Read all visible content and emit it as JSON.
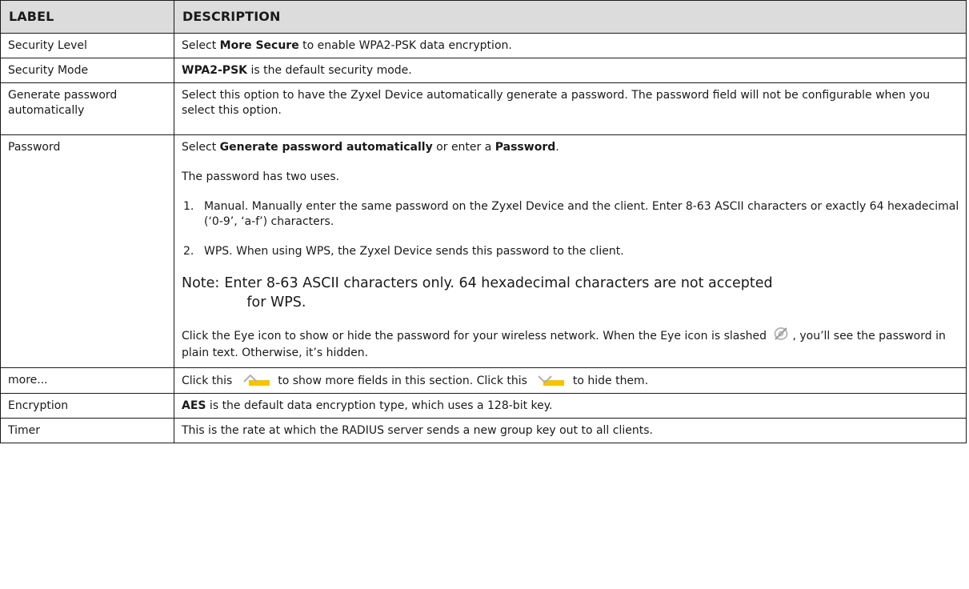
{
  "table": {
    "header": {
      "label": "LABEL",
      "description": "DESCRIPTION"
    },
    "rows": {
      "security_level": {
        "label": "Security Level",
        "pre": "Select ",
        "bold": "More Secure",
        "post": " to enable WPA2-PSK data encryption."
      },
      "security_mode": {
        "label": "Security Mode",
        "bold": "WPA2-PSK",
        "post": " is the default security mode."
      },
      "generate_password": {
        "label": "Generate password automatically",
        "text": "Select this option to have the Zyxel Device automatically generate a password. The password field will not be configurable when you select this option."
      },
      "password": {
        "label": "Password",
        "p1_pre": "Select ",
        "p1_bold1": "Generate password automatically",
        "p1_mid": " or enter a ",
        "p1_bold2": "Password",
        "p1_post": ".",
        "p2": "The password has two uses.",
        "item1_num": "1.",
        "item1_text": "Manual. Manually enter the same password on the Zyxel Device and the client. Enter 8-63 ASCII characters or exactly 64 hexadecimal (‘0-9’, ‘a-f’) characters.",
        "item2_num": "2.",
        "item2_text": "WPS. When using WPS, the Zyxel Device sends this password to the client.",
        "note_label": "Note:",
        "note_line1": "Enter 8-63 ASCII characters only. 64 hexadecimal characters are not accepted",
        "note_line2": "for WPS.",
        "p3_pre": "Click the Eye icon to show or hide the password for your wireless network. When the Eye icon is slashed ",
        "p3_post": ", you’ll see the password in plain text. Otherwise, it’s hidden.",
        "eye_icon": "eye-slash-icon"
      },
      "more": {
        "label": "more...",
        "pre": "Click this ",
        "mid": " to show more fields in this section. Click this ",
        "post": " to hide them.",
        "show_icon": "expand-up-arrow-icon",
        "hide_icon": "collapse-down-arrow-icon",
        "accent_color": "#f5c400"
      },
      "encryption": {
        "label": "Encryption",
        "bold": "AES",
        "post": " is the default data encryption type, which uses a 128-bit key."
      },
      "timer": {
        "label": "Timer",
        "text": "This is the rate at which the RADIUS server sends a new group key out to all clients."
      }
    }
  },
  "colors": {
    "header_bg": "#dcdcdc",
    "border": "#1a1a1a",
    "text": "#1a1a1a"
  }
}
